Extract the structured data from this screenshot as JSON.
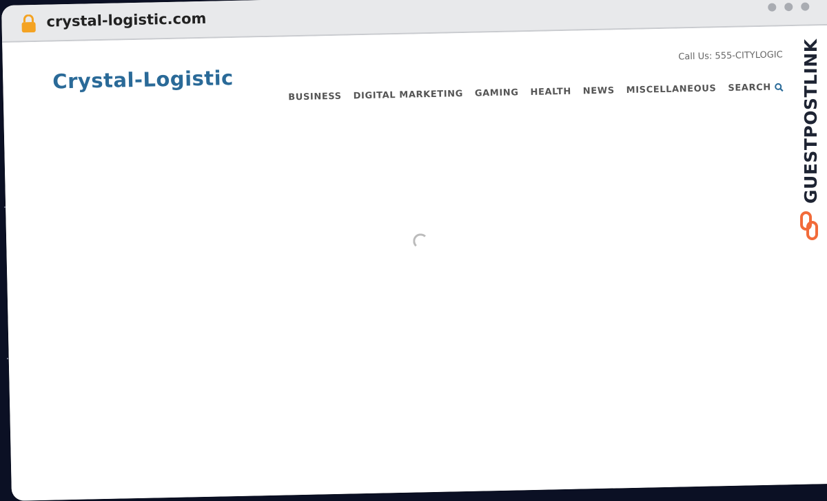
{
  "browser": {
    "url": "crystal-logistic.com",
    "lock_icon": "lock-icon",
    "window_controls": [
      "dot",
      "dot",
      "dot"
    ]
  },
  "site": {
    "logo": "Crystal-Logistic",
    "call_us": "Call Us: 555-CITYLOGIC",
    "nav": [
      {
        "label": "BUSINESS"
      },
      {
        "label": "DIGITAL MARKETING"
      },
      {
        "label": "GAMING"
      },
      {
        "label": "HEALTH"
      },
      {
        "label": "NEWS"
      },
      {
        "label": "MISCELLANEOUS"
      },
      {
        "label": "SEARCH"
      }
    ],
    "search_icon": "search-icon"
  },
  "watermark": {
    "text": "GUESTPOSTLINKS",
    "icon": "link-icon",
    "colors": {
      "text": "#1e2433",
      "icon": "#f26b3a"
    }
  },
  "colors": {
    "logo": "#2a6a98",
    "nav": "#555555",
    "lock": "#f4a323",
    "chrome": "#e8e9eb"
  }
}
